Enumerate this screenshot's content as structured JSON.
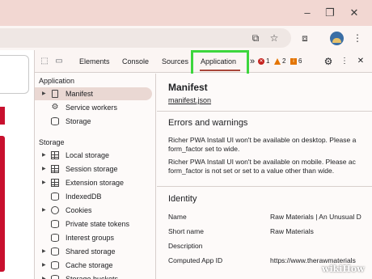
{
  "window": {
    "controls": [
      "minimize-icon",
      "restore-icon",
      "close-icon"
    ]
  },
  "toolbar": {
    "icons": [
      "install-app-icon",
      "star-icon",
      "extensions-icon",
      "profile-avatar"
    ]
  },
  "devtools": {
    "tabs": [
      {
        "label": "Elements"
      },
      {
        "label": "Console"
      },
      {
        "label": "Sources"
      },
      {
        "label": "Application"
      }
    ],
    "more_tabs": "»",
    "errors": "1",
    "warnings": "2",
    "info": "6",
    "accent": "#a8463a",
    "highlight_color": "#3dd63d"
  },
  "sidebar": {
    "application_header": "Application",
    "application_items": [
      {
        "label": "Manifest",
        "icon": "file-icon"
      },
      {
        "label": "Service workers",
        "icon": "gear-icon"
      },
      {
        "label": "Storage",
        "icon": "database-icon"
      }
    ],
    "storage_header": "Storage",
    "storage_items": [
      {
        "label": "Local storage",
        "icon": "grid-icon"
      },
      {
        "label": "Session storage",
        "icon": "grid-icon"
      },
      {
        "label": "Extension storage",
        "icon": "grid-icon"
      },
      {
        "label": "IndexedDB",
        "icon": "database-icon"
      },
      {
        "label": "Cookies",
        "icon": "cookie-icon"
      },
      {
        "label": "Private state tokens",
        "icon": "database-icon"
      },
      {
        "label": "Interest groups",
        "icon": "database-icon"
      },
      {
        "label": "Shared storage",
        "icon": "database-icon"
      },
      {
        "label": "Cache storage",
        "icon": "database-icon"
      },
      {
        "label": "Storage buckets",
        "icon": "database-icon"
      }
    ]
  },
  "main": {
    "title": "Manifest",
    "link": "manifest.json",
    "errors_header": "Errors and warnings",
    "warning_1_line1": "Richer PWA Install UI won't be available on desktop. Please a",
    "warning_1_line2": "form_factor set to wide.",
    "warning_2_line1": "Richer PWA Install UI won't be available on mobile. Please ac",
    "warning_2_line2": "form_factor is not set or set to a value other than wide.",
    "identity_header": "Identity",
    "rows": [
      {
        "label": "Name",
        "value": "Raw Materials | An Unusual D"
      },
      {
        "label": "Short name",
        "value": "Raw Materials"
      },
      {
        "label": "Description",
        "value": ""
      },
      {
        "label": "Computed App ID",
        "value": "https://www.therawmaterials"
      }
    ]
  },
  "watermark": "wikiHow"
}
